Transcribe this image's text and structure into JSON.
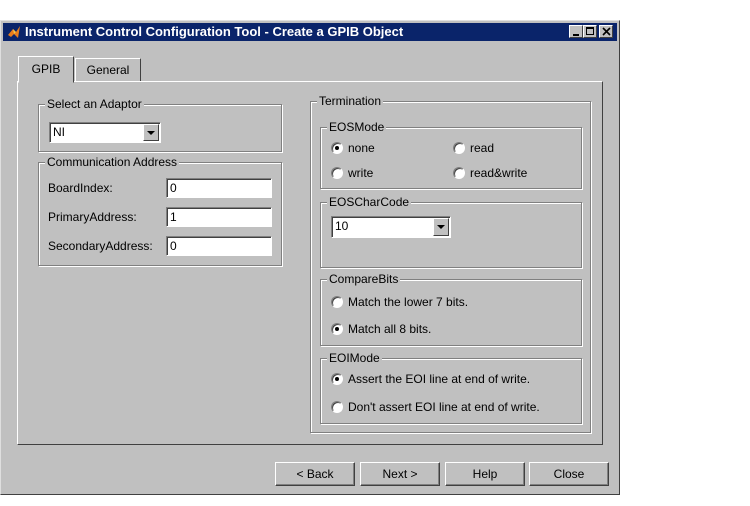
{
  "window": {
    "title": "Instrument Control Configuration Tool - Create a GPIB Object"
  },
  "tabs": [
    {
      "label": "GPIB"
    },
    {
      "label": "General"
    }
  ],
  "adaptor": {
    "legend": "Select an Adaptor",
    "selected": "NI"
  },
  "address": {
    "legend": "Communication Address",
    "board_label": "BoardIndex:",
    "board_value": "0",
    "primary_label": "PrimaryAddress:",
    "primary_value": "1",
    "secondary_label": "SecondaryAddress:",
    "secondary_value": "0"
  },
  "termination": {
    "legend": "Termination",
    "eosmode": {
      "legend": "EOSMode",
      "none": "none",
      "read": "read",
      "write": "write",
      "readwrite": "read&write",
      "selected": "none"
    },
    "eoscharcode": {
      "legend": "EOSCharCode",
      "selected": "10"
    },
    "comparebits": {
      "legend": "CompareBits",
      "opt7": "Match the lower 7 bits.",
      "opt8": "Match all 8 bits.",
      "selected": "opt8"
    },
    "eoimode": {
      "legend": "EOIMode",
      "assert": "Assert the EOI line at end of write.",
      "noassert": "Don't assert EOI line at end of write.",
      "selected": "assert"
    }
  },
  "buttons": {
    "back": "< Back",
    "next": "Next >",
    "help": "Help",
    "close": "Close"
  }
}
